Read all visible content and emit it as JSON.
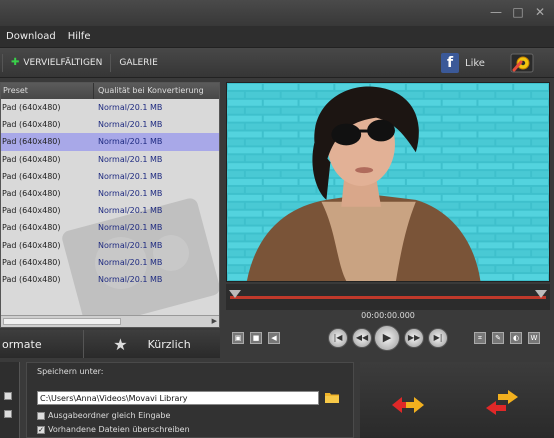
{
  "window": {
    "controls": [
      "—",
      "□",
      "✕"
    ]
  },
  "menu": {
    "items": [
      "Download",
      "Hilfe"
    ]
  },
  "toolbar": {
    "multiply_label": "VERVIELFÄLTIGEN",
    "gallery_label": "GALERIE",
    "facebook_like": "Like"
  },
  "presets": {
    "headers": [
      "Preset",
      "Qualität bei Konvertierung"
    ],
    "rows": [
      {
        "preset": "Pad (640x480)",
        "quality": "Normal/20.1 MB"
      },
      {
        "preset": "Pad (640x480)",
        "quality": "Normal/20.1 MB"
      },
      {
        "preset": "Pad (640x480)",
        "quality": "Normal/20.1 MB"
      },
      {
        "preset": "Pad (640x480)",
        "quality": "Normal/20.1 MB"
      },
      {
        "preset": "Pad (640x480)",
        "quality": "Normal/20.1 MB"
      },
      {
        "preset": "Pad (640x480)",
        "quality": "Normal/20.1 MB"
      },
      {
        "preset": "Pad (640x480)",
        "quality": "Normal/20.1 MB"
      },
      {
        "preset": "Pad (640x480)",
        "quality": "Normal/20.1 MB"
      },
      {
        "preset": "Pad (640x480)",
        "quality": "Normal/20.1 MB"
      },
      {
        "preset": "Pad (640x480)",
        "quality": "Normal/20.1 MB"
      },
      {
        "preset": "Pad (640x480)",
        "quality": "Normal/20.1 MB"
      }
    ],
    "selected_index": 2
  },
  "tabs": {
    "formats_label": "ormate",
    "recent_label": "Kürzlich"
  },
  "player": {
    "timecode": "00:00:00.000"
  },
  "save": {
    "label": "Speichern unter:",
    "path": "C:\\Users\\Anna\\Videos\\Movavi Library",
    "option_same_folder": "Ausgabeordner gleich Eingabe",
    "option_overwrite": "Vorhandene Dateien überschreiben"
  },
  "colors": {
    "selection": "#a8a8e8",
    "quality_text": "#1e2a80",
    "timeline": "#c0392b",
    "facebook": "#3b5998"
  }
}
